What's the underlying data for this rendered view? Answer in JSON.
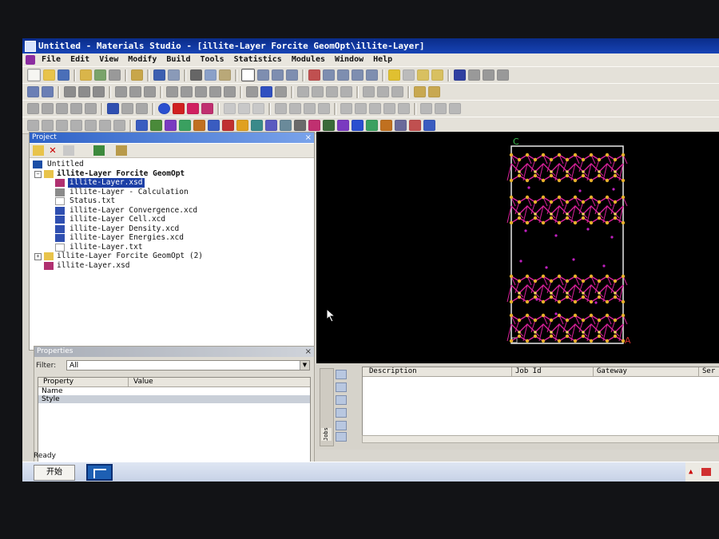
{
  "window": {
    "title": "Untitled - Materials Studio - [illite-Layer Forcite GeomOpt\\illite-Layer]"
  },
  "menubar": {
    "items": [
      "File",
      "Edit",
      "View",
      "Modify",
      "Build",
      "Tools",
      "Statistics",
      "Modules",
      "Window",
      "Help"
    ]
  },
  "project": {
    "header": "Project",
    "close": "×",
    "tree": [
      {
        "label": "Untitled",
        "icon": "project-icon",
        "level": 0
      },
      {
        "label": "illite-Layer Forcite GeomOpt",
        "icon": "folder-open-icon",
        "level": 1,
        "bold": true
      },
      {
        "label": "illite-Layer.xsd",
        "icon": "molecule-icon",
        "level": 2,
        "selected": true
      },
      {
        "label": "illite-Layer - Calculation",
        "icon": "calculation-icon",
        "level": 2
      },
      {
        "label": "Status.txt",
        "icon": "text-file-icon",
        "level": 2
      },
      {
        "label": "illite-Layer Convergence.xcd",
        "icon": "chart-file-icon",
        "level": 2
      },
      {
        "label": "illite-Layer Cell.xcd",
        "icon": "chart-file-icon",
        "level": 2
      },
      {
        "label": "illite-Layer Density.xcd",
        "icon": "chart-file-icon",
        "level": 2
      },
      {
        "label": "illite-Layer Energies.xcd",
        "icon": "chart-file-icon",
        "level": 2
      },
      {
        "label": "illite-Layer.txt",
        "icon": "text-file-icon",
        "level": 2
      },
      {
        "label": "illite-Layer Forcite GeomOpt (2)",
        "icon": "folder-icon",
        "level": 1
      },
      {
        "label": "illite-Layer.xsd",
        "icon": "molecule-icon",
        "level": 1
      }
    ]
  },
  "properties": {
    "header": "Properties",
    "close": "×",
    "filter_label": "Filter:",
    "filter_value": "All",
    "columns": [
      "Property",
      "Value"
    ],
    "rows": [
      "Name",
      "Style"
    ]
  },
  "viewer": {
    "axis_c": "C",
    "axis_a": "A"
  },
  "jobs": {
    "tab_label": "Jobs",
    "columns": [
      "Description",
      "Job Id",
      "Gateway",
      "Ser"
    ]
  },
  "statusbar": {
    "text": "Ready"
  },
  "taskbar": {
    "start_label": "开始"
  },
  "colors": {
    "titlebar": "#0a2c8a",
    "selection": "#1c3fa6",
    "viewer_bg": "#000000",
    "bond_magenta": "#d8209a",
    "atom_yellow": "#e6b02a",
    "cell_white": "#e8e8e8"
  }
}
